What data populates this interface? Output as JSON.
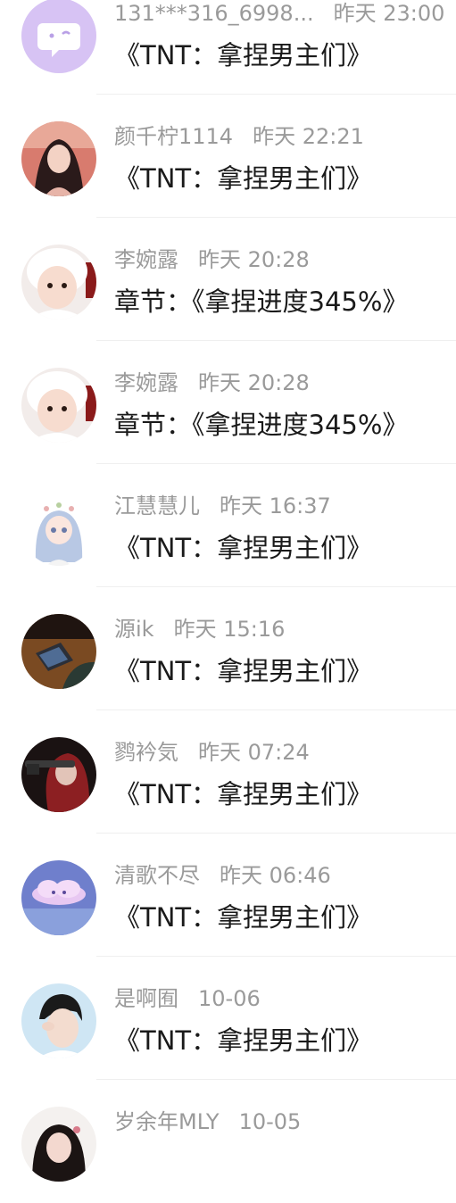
{
  "comments": [
    {
      "name": "131***316_6998...",
      "time": "昨天 23:00",
      "text": "《TNT：拿捏男主们》",
      "avatar": "default-chat-avatar"
    },
    {
      "name": "颜千柠1114",
      "time": "昨天 22:21",
      "text": "《TNT：拿捏男主们》",
      "avatar": "girl-photo-avatar"
    },
    {
      "name": "李婉露",
      "time": "昨天 20:28",
      "text": "章节：《拿捏进度345%》",
      "avatar": "baby-photo-avatar"
    },
    {
      "name": "李婉露",
      "time": "昨天 20:28",
      "text": "章节：《拿捏进度345%》",
      "avatar": "baby-photo-avatar"
    },
    {
      "name": "江慧慧儿",
      "time": "昨天 16:37",
      "text": "《TNT：拿捏男主们》",
      "avatar": "anime-girl-avatar"
    },
    {
      "name": "源ik",
      "time": "昨天 15:16",
      "text": "《TNT：拿捏男主们》",
      "avatar": "laptop-photo-avatar"
    },
    {
      "name": "鹨衿気",
      "time": "昨天 07:24",
      "text": "《TNT：拿捏男主们》",
      "avatar": "red-hair-avatar"
    },
    {
      "name": "清歌不尽",
      "time": "昨天 06:46",
      "text": "《TNT：拿捏男主们》",
      "avatar": "cloud-art-avatar"
    },
    {
      "name": "是啊囿",
      "time": "10-06",
      "text": "《TNT：拿捏男主们》",
      "avatar": "boy-photo-avatar"
    },
    {
      "name": "岁余年MLY",
      "time": "10-05",
      "text": "",
      "avatar": "girl-hair-avatar"
    }
  ],
  "colors": {
    "name_time": "#9a9a9a",
    "message": "#1a1a1a",
    "divider": "#efefef",
    "default_avatar_bg": "#d7c3f4"
  }
}
